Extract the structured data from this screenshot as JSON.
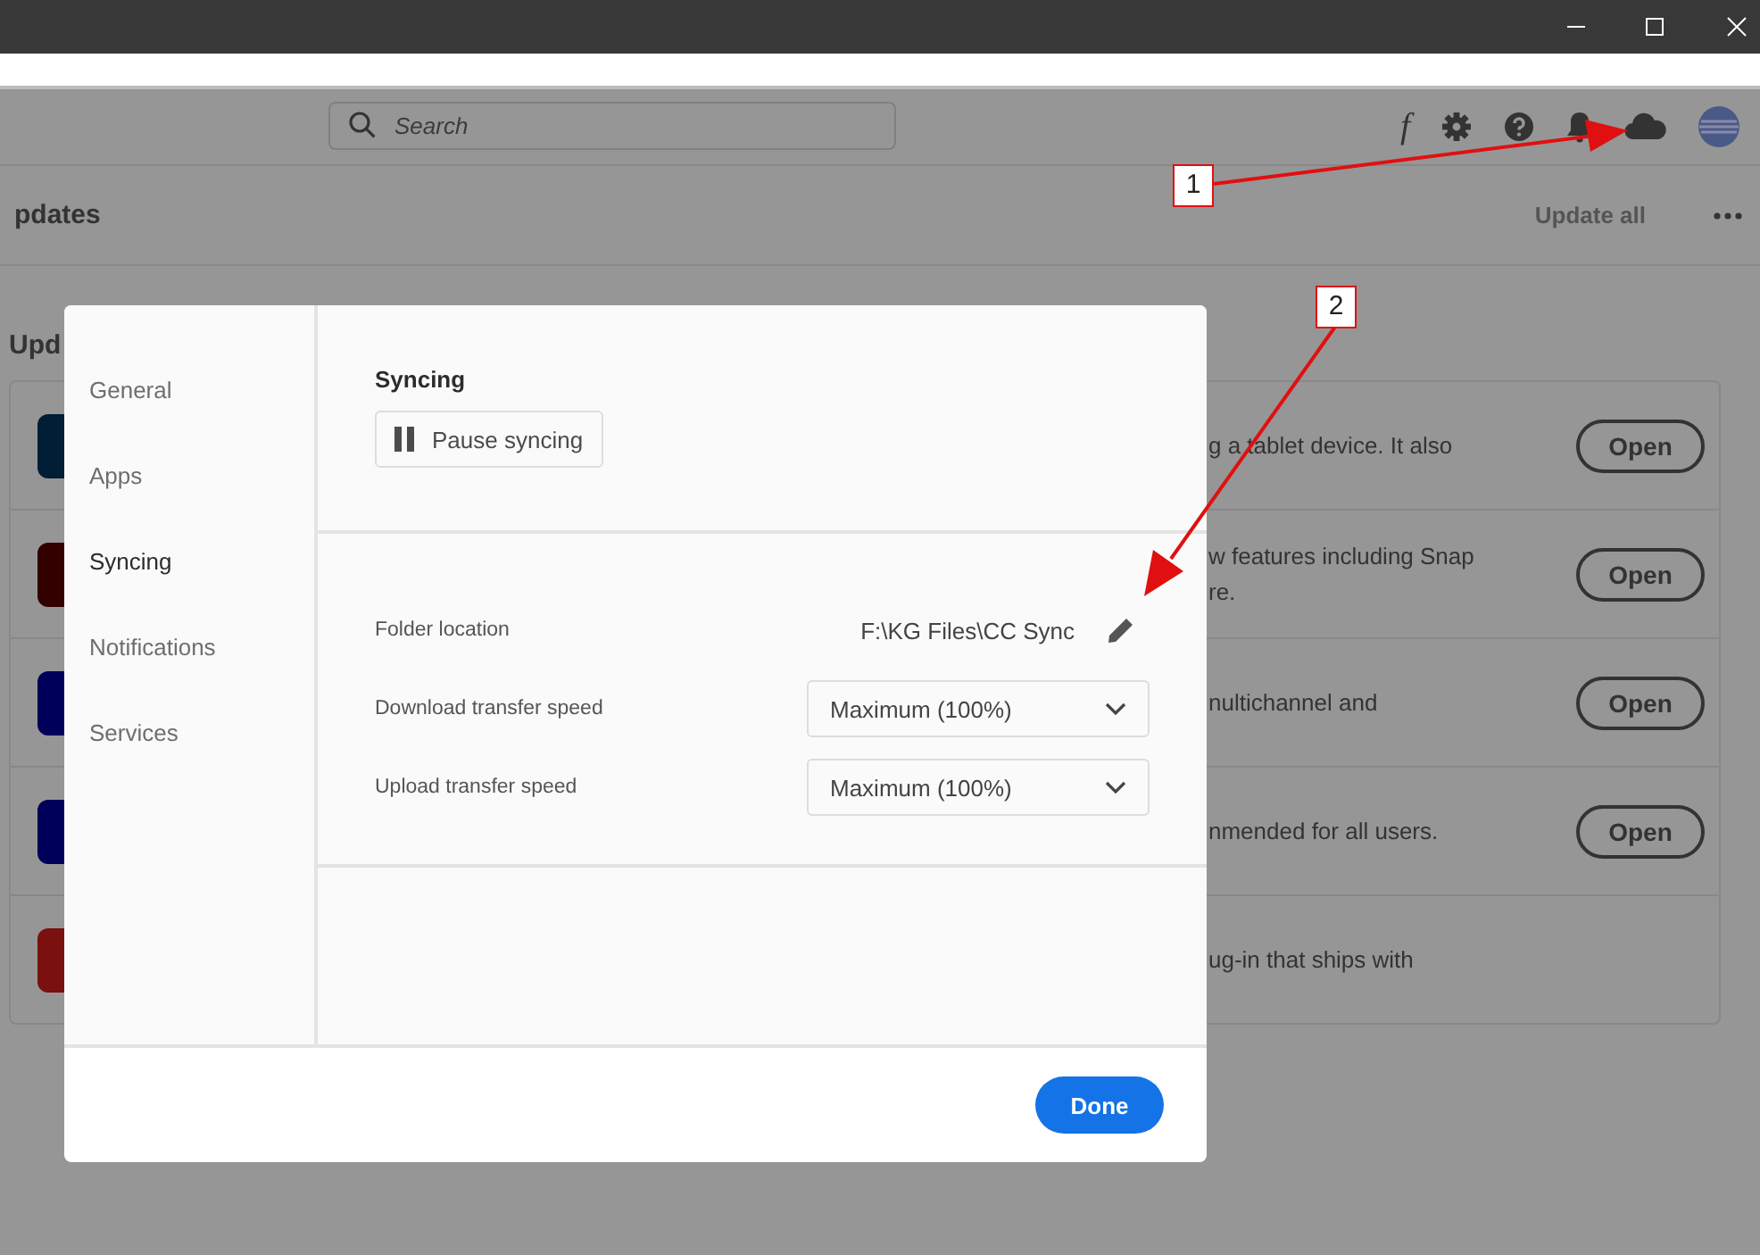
{
  "header": {
    "search": {
      "placeholder": "Search"
    },
    "font_icon": "f"
  },
  "page": {
    "title": "pdates",
    "update_all": {
      "label": "Update all",
      "disabled": true
    },
    "section_heading": "Upd"
  },
  "apps": [
    {
      "color": "#001e36",
      "lines": [
        "g a tablet device. It also"
      ],
      "open": "Open"
    },
    {
      "color": "#330000",
      "lines": [
        "w features including Snap",
        "re."
      ],
      "open": "Open"
    },
    {
      "color": "#00005b",
      "lines": [
        "nultichannel and"
      ],
      "open": "Open"
    },
    {
      "color": "#00005b",
      "lines": [
        "nmended for all users."
      ],
      "open": "Open"
    },
    {
      "color": "#7a1010",
      "lines": [
        "ug-in that ships with"
      ]
    }
  ],
  "dialog": {
    "nav": [
      {
        "label": "General",
        "selected": false
      },
      {
        "label": "Apps",
        "selected": false
      },
      {
        "label": "Syncing",
        "selected": true
      },
      {
        "label": "Notifications",
        "selected": false
      },
      {
        "label": "Services",
        "selected": false
      }
    ],
    "section_title": "Syncing",
    "pause_button": "Pause syncing",
    "settings": [
      {
        "kind": "path",
        "label": "Folder location",
        "value": "F:\\KG Files\\CC Sync"
      },
      {
        "kind": "dropdown",
        "label": "Download transfer speed",
        "value": "Maximum (100%)"
      },
      {
        "kind": "dropdown",
        "label": "Upload transfer speed",
        "value": "Maximum (100%)"
      }
    ],
    "done": "Done"
  },
  "annotations": [
    {
      "number": "1"
    },
    {
      "number": "2"
    }
  ]
}
